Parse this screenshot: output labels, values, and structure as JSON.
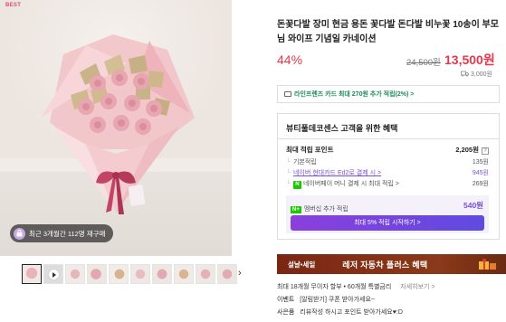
{
  "gallery": {
    "best_tag": "BEST",
    "promo_badge": "최근 3개월간 112명 재구매",
    "thumbnail_count": 10
  },
  "product": {
    "title": "돈꽃다발 장미 현금 용돈 꽃다발 돈다발 비누꽃 10송이 부모님 와이프 기념일 카네이션",
    "discount": "44%",
    "original_price": "24,500원",
    "sale_price": "13,500원",
    "shipping_fee": "3,000원"
  },
  "card_promo": {
    "text": "라인프렌즈 카드 최대 270원 추가 적립(2%) >"
  },
  "benefit": {
    "heading": "뷰티풀데코센스 고객을 위한 혜택",
    "total_label": "최대 적립 포인트",
    "total_value": "2,205원",
    "basic_label": "기본적립",
    "basic_value": "135원",
    "card_label": "네이버 현대카드 Ed2로 결제 시 >",
    "card_value": "945원",
    "money_label": "네이버페이 머니 결제 시 최대 적립 >",
    "money_value": "269원",
    "membership_chip": "N+",
    "membership_label": "멤버십 추가 적립",
    "membership_value": "540원",
    "membership_cta": "최대 5% 적립 시작하기 >"
  },
  "banner": {
    "left": "설날•세일",
    "main": "레저 자동차 플러스 혜택"
  },
  "extras": {
    "install_text": "최대 18개월 무이자 할부 • 60개월 특별금리",
    "install_more": "자세히보기 >",
    "event_label": "이벤트",
    "event_text": "[알림받기] 쿠폰 받아가세요~",
    "gift_label": "사은품",
    "gift_text": "리뷰작성 하시고 포인트 받아가세요♥:D"
  },
  "colors": {
    "accent_red": "#e8364a",
    "naver_green": "#1ec800",
    "purple": "#7a4fd8",
    "banner_brown": "#7a2613"
  }
}
